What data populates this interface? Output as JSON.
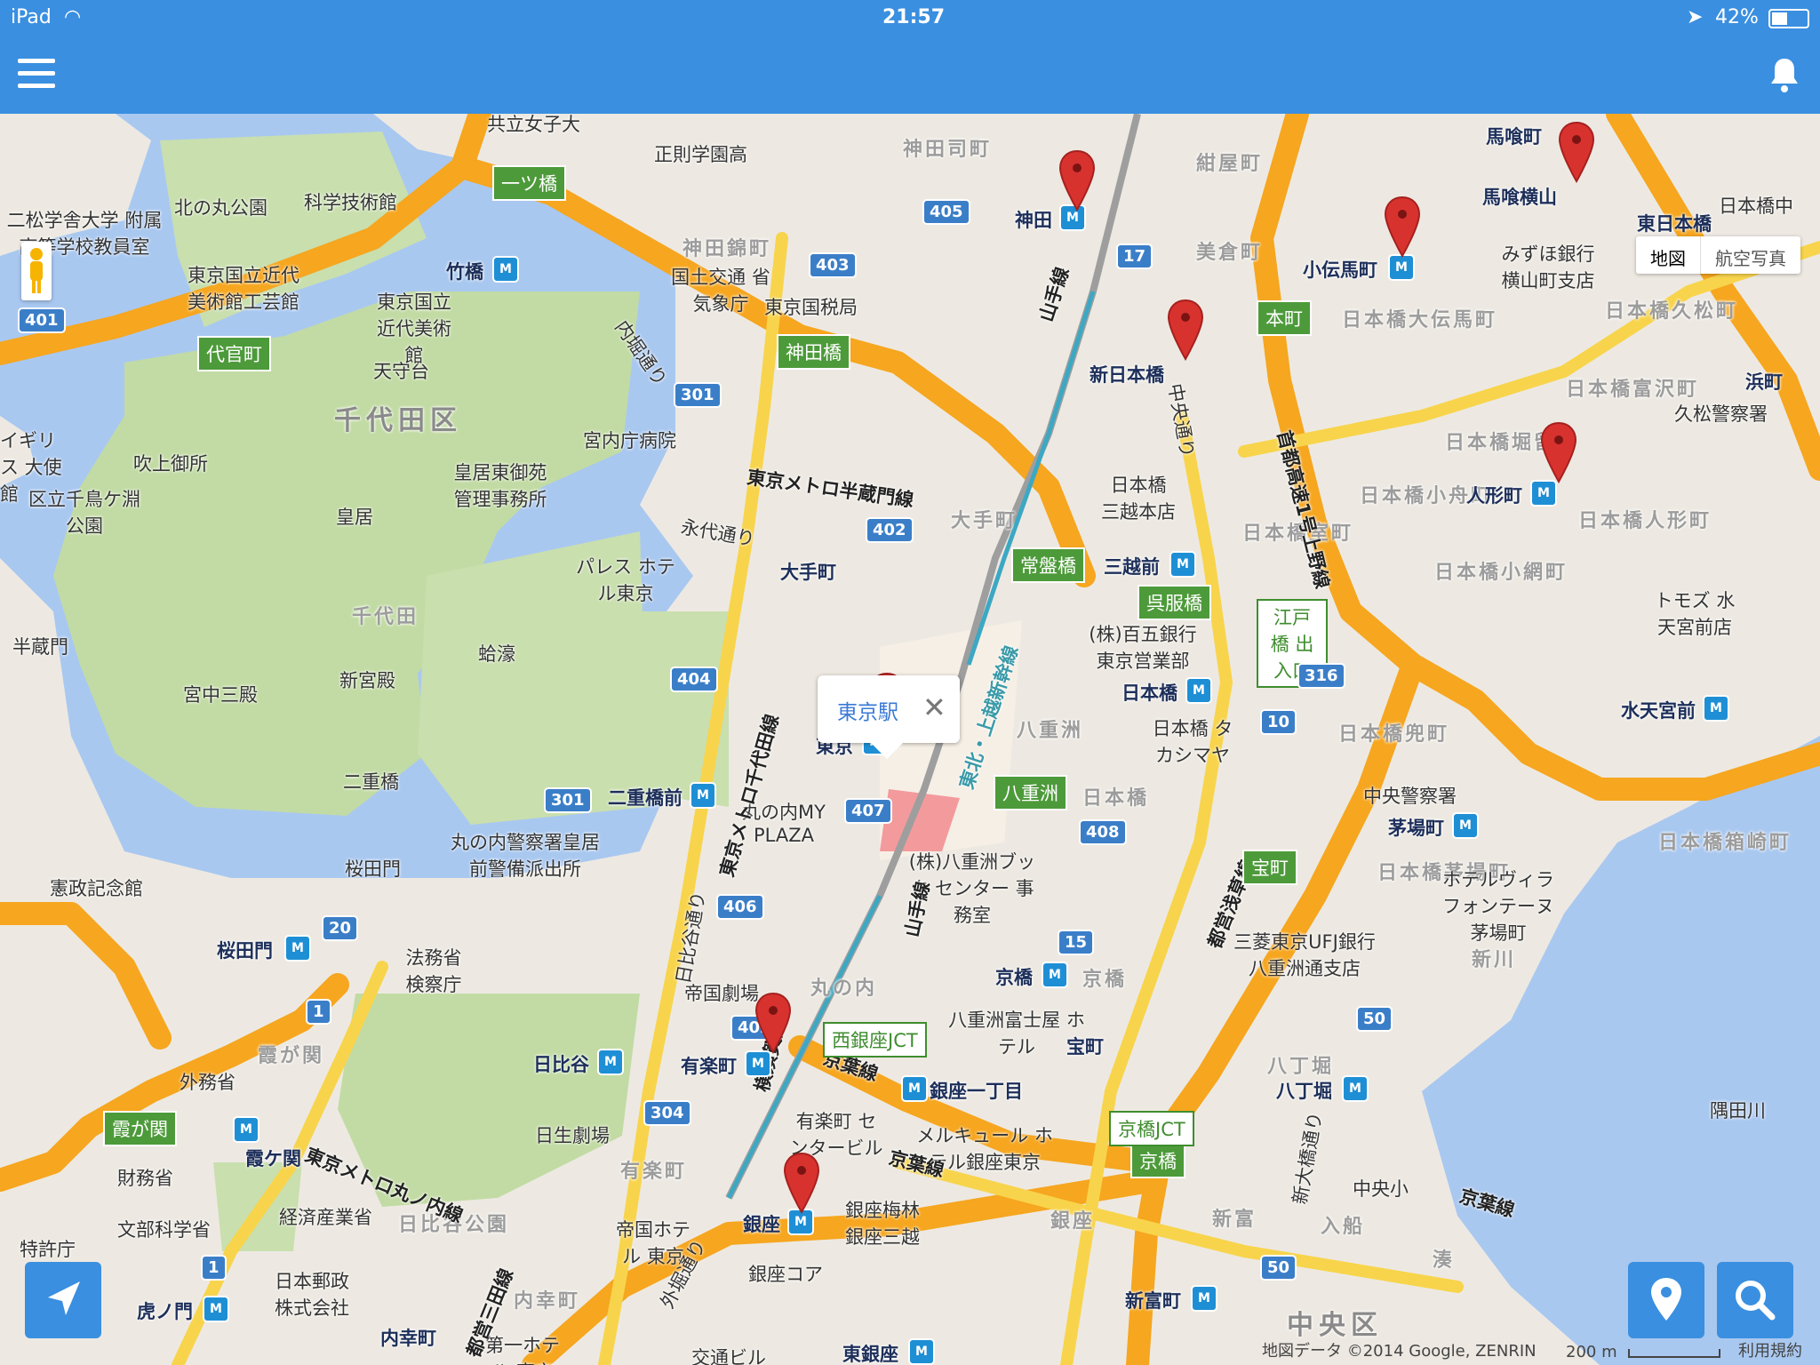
{
  "status": {
    "carrier": "iPad",
    "time": "21:57",
    "battery": "42%"
  },
  "map": {
    "callout_title": "東京駅",
    "maptype": {
      "map": "地図",
      "satellite": "航空写真"
    },
    "footer": {
      "attribution": "地図データ ©2014 Google, ZENRIN",
      "scale": "200 m",
      "terms": "利用規約"
    },
    "districts": [
      "千代田区",
      "中央区"
    ],
    "area_labels": [
      "千代田",
      "丸の内",
      "日比谷公園",
      "有楽町",
      "日本橋",
      "八重洲",
      "京橋",
      "銀座",
      "八丁堀",
      "新富",
      "入船",
      "湊",
      "新川",
      "霞が関",
      "内幸町",
      "神田司町",
      "神田錦町",
      "紺屋町",
      "美倉町",
      "大手町",
      "日本橋大伝馬町",
      "日本橋久松町",
      "日本橋富沢町",
      "日本橋堀留町",
      "日本橋小舟町",
      "日本橋室町",
      "日本橋人形町",
      "日本橋小網町",
      "日本橋兜町",
      "日本橋茅場町",
      "日本橋箱崎町"
    ],
    "places": [
      "皇居",
      "宮中三殿",
      "新宮殿",
      "二重橋",
      "桜田門",
      "皇居東御苑 管理事務所",
      "宮内庁病院",
      "天守台",
      "吹上御所",
      "北の丸公園",
      "科学技術館",
      "東京国立近代 美術館工芸館",
      "東京国立 近代美術館",
      "国土交通 省 気象庁",
      "東京国税局",
      "正則学園高",
      "共立女子大",
      "パレス ホテル東京",
      "丸の内MY PLAZA",
      "丸の内警察署皇居 前警備派出所",
      "法務省 検察庁",
      "憲政記念館",
      "外務省",
      "財務省",
      "文部科学省",
      "経済産業省",
      "日本郵政 株式会社",
      "帝国劇場",
      "日生劇場",
      "帝国ホテル 東京",
      "有楽町 センタービル",
      "八重洲富士屋 ホテル",
      "(株)八重洲ブック センター 事務室",
      "(株)百五銀行 東京営業部",
      "日本橋 タカシマヤ",
      "日本橋 三越本店",
      "みずほ銀行 横山町支店",
      "久松警察署",
      "中央警察署",
      "三菱東京UFJ銀行 八重洲通支店",
      "ホテルヴィラ フォンテーヌ 茅場町",
      "メルキュール ホテル銀座東京",
      "銀座梅林 銀座三越",
      "銀座コア",
      "中央小",
      "トモズ 水 天宮前店",
      "日本橋中",
      "区立千鳥ケ淵 公園",
      "二松学舎大学 附属 高等学校教員室",
      "隅田川",
      "蛤濠",
      "半蔵門",
      "内堀通り",
      "永代通り",
      "日比谷通り",
      "外堀通り",
      "中央通り",
      "新大橋通り",
      "交通ビル DINNINGS & STORES",
      "第一ホテル 東京",
      "特許庁",
      "イギリス 大使館"
    ],
    "lines": [
      "東京メトロ半蔵門線",
      "東京メトロ千代田線",
      "東京メトロ丸ノ内線",
      "横須賀線",
      "京葉線",
      "山手線",
      "東北・上越新幹線",
      "都営浅草線",
      "首都高速1号上野線",
      "都営三田線"
    ],
    "stations": [
      "神田",
      "小伝馬町",
      "馬喰横山",
      "馬喰町",
      "東日本橋",
      "新日本橋",
      "人形町",
      "浜町",
      "三越前",
      "大手町",
      "東京",
      "二重橋前",
      "日本橋",
      "水天宮前",
      "茅場町",
      "京橋",
      "宝町",
      "八丁堀",
      "銀座一丁目",
      "有楽町",
      "日比谷",
      "銀座",
      "新富町",
      "東銀座",
      "霞ケ関",
      "桜田門",
      "竹橋",
      "内幸町",
      "虎ノ門"
    ],
    "green_signs": [
      "一ツ橋",
      "代官町",
      "神田橋",
      "本町",
      "常盤橋",
      "呉服橋",
      "八重洲",
      "宝町",
      "京橋",
      "霞が関"
    ],
    "outline_signs": [
      "江戸橋 出入口",
      "西銀座JCT",
      "京橋JCT"
    ],
    "route_shields": [
      "405",
      "403",
      "301",
      "402",
      "404",
      "401",
      "17",
      "316",
      "10",
      "408",
      "407",
      "406",
      "301",
      "15",
      "20",
      "1",
      "402",
      "304",
      "50",
      "1",
      "50"
    ]
  }
}
